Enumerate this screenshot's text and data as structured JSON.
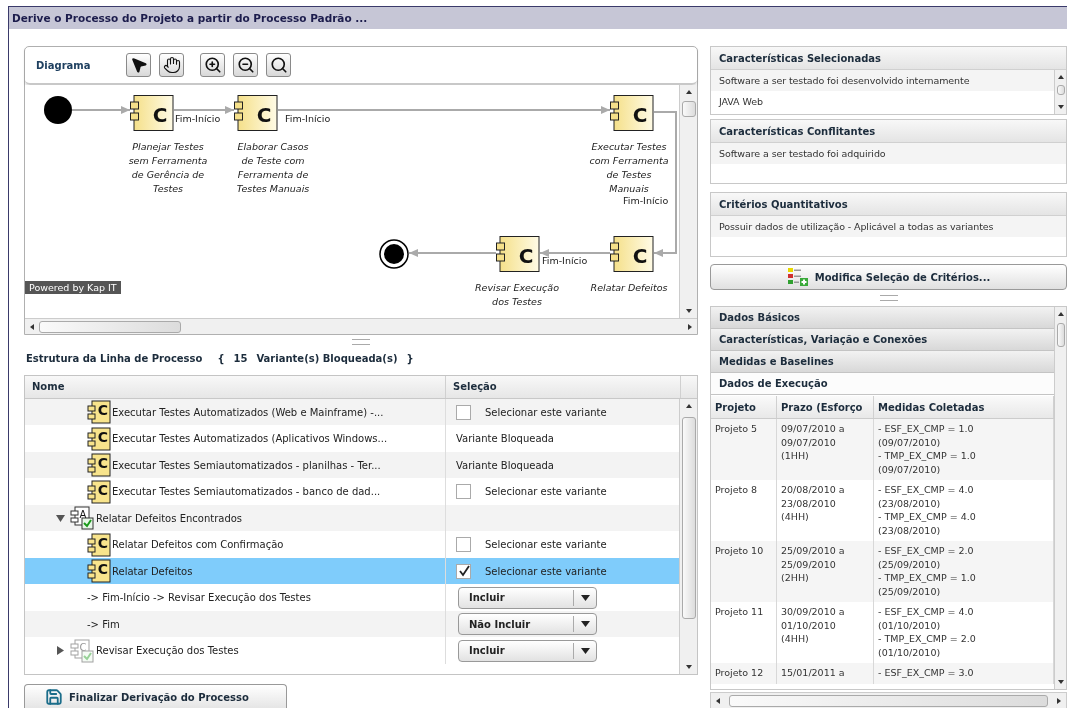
{
  "window": {
    "title": "Derive o Processo do Projeto a partir do Processo Padrão ..."
  },
  "diagram": {
    "title": "Diagrama",
    "tools": [
      {
        "kind": "pointer"
      },
      {
        "kind": "hand"
      },
      {
        "kind": "zoom-in"
      },
      {
        "kind": "zoom-out"
      },
      {
        "kind": "zoom-reset"
      }
    ],
    "nodes": [
      {
        "kind": "start"
      },
      {
        "kind": "component",
        "letter": "C",
        "label": [
          "Planejar Testes",
          "sem Ferramenta",
          "de Gerência de",
          "Testes"
        ]
      },
      {
        "kind": "component",
        "letter": "C",
        "label": [
          "Elaborar Casos",
          "de Teste com",
          "Ferramenta de",
          "Testes Manuais"
        ]
      },
      {
        "kind": "component",
        "letter": "C",
        "label": [
          "Executar Testes",
          "com Ferramenta",
          "de Testes",
          "Manuais"
        ]
      },
      {
        "kind": "end"
      },
      {
        "kind": "component",
        "letter": "C",
        "label": [
          "Revisar Execução",
          "dos Testes"
        ]
      },
      {
        "kind": "component",
        "letter": "C",
        "label": [
          "Relatar Defeitos"
        ]
      }
    ],
    "edge_labels": [
      "Fim-Início",
      "Fim-Início",
      "Fim-Início",
      "Fim-Início"
    ],
    "badge": "Powered by Kap IT"
  },
  "process_tree": {
    "title": "Estrutura da Linha de Processo",
    "brace_open": "{",
    "blocked_count": "15",
    "blocked_label": "Variante(s) Bloqueada(s)",
    "brace_close": "}",
    "columns": [
      "Nome",
      "Seleção"
    ],
    "rows": [
      {
        "kind": "continuation",
        "children": [
          {
            "kind": "variant",
            "letter": "C",
            "name": "Executar Testes Automatizados (Web e Mainframe) -...",
            "selected": false,
            "selection": {
              "kind": "checkbox",
              "label": "Selecionar este variante",
              "checked": false
            }
          },
          {
            "kind": "variant",
            "letter": "C",
            "name": "Executar Testes Automatizados (Aplicativos Windows...",
            "selected": false,
            "selection": {
              "kind": "blocked",
              "label": "Variante Bloqueada"
            }
          },
          {
            "kind": "variant",
            "letter": "C",
            "name": "Executar Testes Semiautomatizados - planilhas - Ter...",
            "selected": false,
            "selection": {
              "kind": "blocked",
              "label": "Variante Bloqueada"
            }
          },
          {
            "kind": "variant",
            "letter": "C",
            "name": "Executar Testes Semiautomatizados - banco de dad...",
            "selected": false,
            "selection": {
              "kind": "checkbox",
              "label": "Selecionar este variante",
              "checked": false
            }
          }
        ]
      },
      {
        "kind": "activity",
        "letter": "A",
        "name": "Relatar Defeitos Encontrados",
        "expanded": true,
        "dimmed": false,
        "selected": false,
        "children": [
          {
            "kind": "variant",
            "letter": "C",
            "name": "Relatar Defeitos com Confirmação",
            "selected": false,
            "selection": {
              "kind": "checkbox",
              "label": "Selecionar este variante",
              "checked": false
            }
          },
          {
            "kind": "variant",
            "letter": "C",
            "name": "Relatar Defeitos",
            "selected": true,
            "selection": {
              "kind": "checkbox",
              "label": "Selecionar este variante",
              "checked": true
            },
            "children": [
              {
                "kind": "link",
                "name": "-> Fim-Início -> Revisar Execução dos Testes",
                "selected": false,
                "selection": {
                  "kind": "dropdown",
                  "value": "Incluir"
                }
              },
              {
                "kind": "link",
                "name": "-> Fim",
                "selected": false,
                "selection": {
                  "kind": "dropdown",
                  "value": "Não Incluir"
                }
              }
            ]
          }
        ]
      },
      {
        "kind": "activity",
        "letter": "C",
        "name": "Revisar Execução dos Testes",
        "expanded": false,
        "dimmed": true,
        "selected": false,
        "selection": {
          "kind": "dropdown",
          "value": "Incluir"
        }
      }
    ]
  },
  "finish_button": {
    "label": "Finalizar Derivação do Processo"
  },
  "selected_characteristics": {
    "title": "Características Selecionadas",
    "items": [
      "Software a ser testado foi desenvolvido internamente",
      "JAVA Web"
    ]
  },
  "conflicting_characteristics": {
    "title": "Características Conflitantes",
    "items": [
      "Software a ser testado foi adquirido"
    ]
  },
  "quantitative_criteria": {
    "title": "Critérios Quantitativos",
    "items": [
      "Possuir dados de utilização - Aplicável a todas as variantes"
    ]
  },
  "criteria_button": {
    "label": "Modifica Seleção de Critérios..."
  },
  "details": {
    "sections": [
      {
        "title": "Dados Básicos",
        "expanded": false
      },
      {
        "title": "Características, Variação e Conexões",
        "expanded": false
      },
      {
        "title": "Medidas e Baselines",
        "expanded": false
      },
      {
        "title": "Dados de Execução",
        "expanded": true
      }
    ],
    "execution_table": {
      "columns": [
        "Projeto",
        "Prazo (Esforço",
        "Medidas Coletadas"
      ],
      "rows": [
        {
          "project": "Projeto 5",
          "period": [
            "09/07/2010 a",
            "09/07/2010",
            "(1HH)"
          ],
          "measures": [
            "- ESF_EX_CMP = 1.0",
            "(09/07/2010)",
            "- TMP_EX_CMP = 1.0",
            "(09/07/2010)"
          ]
        },
        {
          "project": "Projeto 8",
          "period": [
            "20/08/2010 a",
            "23/08/2010",
            "(4HH)"
          ],
          "measures": [
            "- ESF_EX_CMP = 4.0",
            "(23/08/2010)",
            "- TMP_EX_CMP = 4.0",
            "(23/08/2010)"
          ]
        },
        {
          "project": "Projeto 10",
          "period": [
            "25/09/2010 a",
            "25/09/2010",
            "(2HH)"
          ],
          "measures": [
            "- ESF_EX_CMP = 2.0",
            "(25/09/2010)",
            "- TMP_EX_CMP = 1.0",
            "(25/09/2010)"
          ]
        },
        {
          "project": "Projeto 11",
          "period": [
            "30/09/2010 a",
            "01/10/2010",
            "(4HH)"
          ],
          "measures": [
            "- ESF_EX_CMP = 4.0",
            "(01/10/2010)",
            "- TMP_EX_CMP = 2.0",
            "(01/10/2010)"
          ]
        },
        {
          "project": "Projeto 12",
          "period": [
            "15/01/2011 a"
          ],
          "measures": [
            "- ESF_EX_CMP = 3.0"
          ]
        }
      ]
    }
  }
}
